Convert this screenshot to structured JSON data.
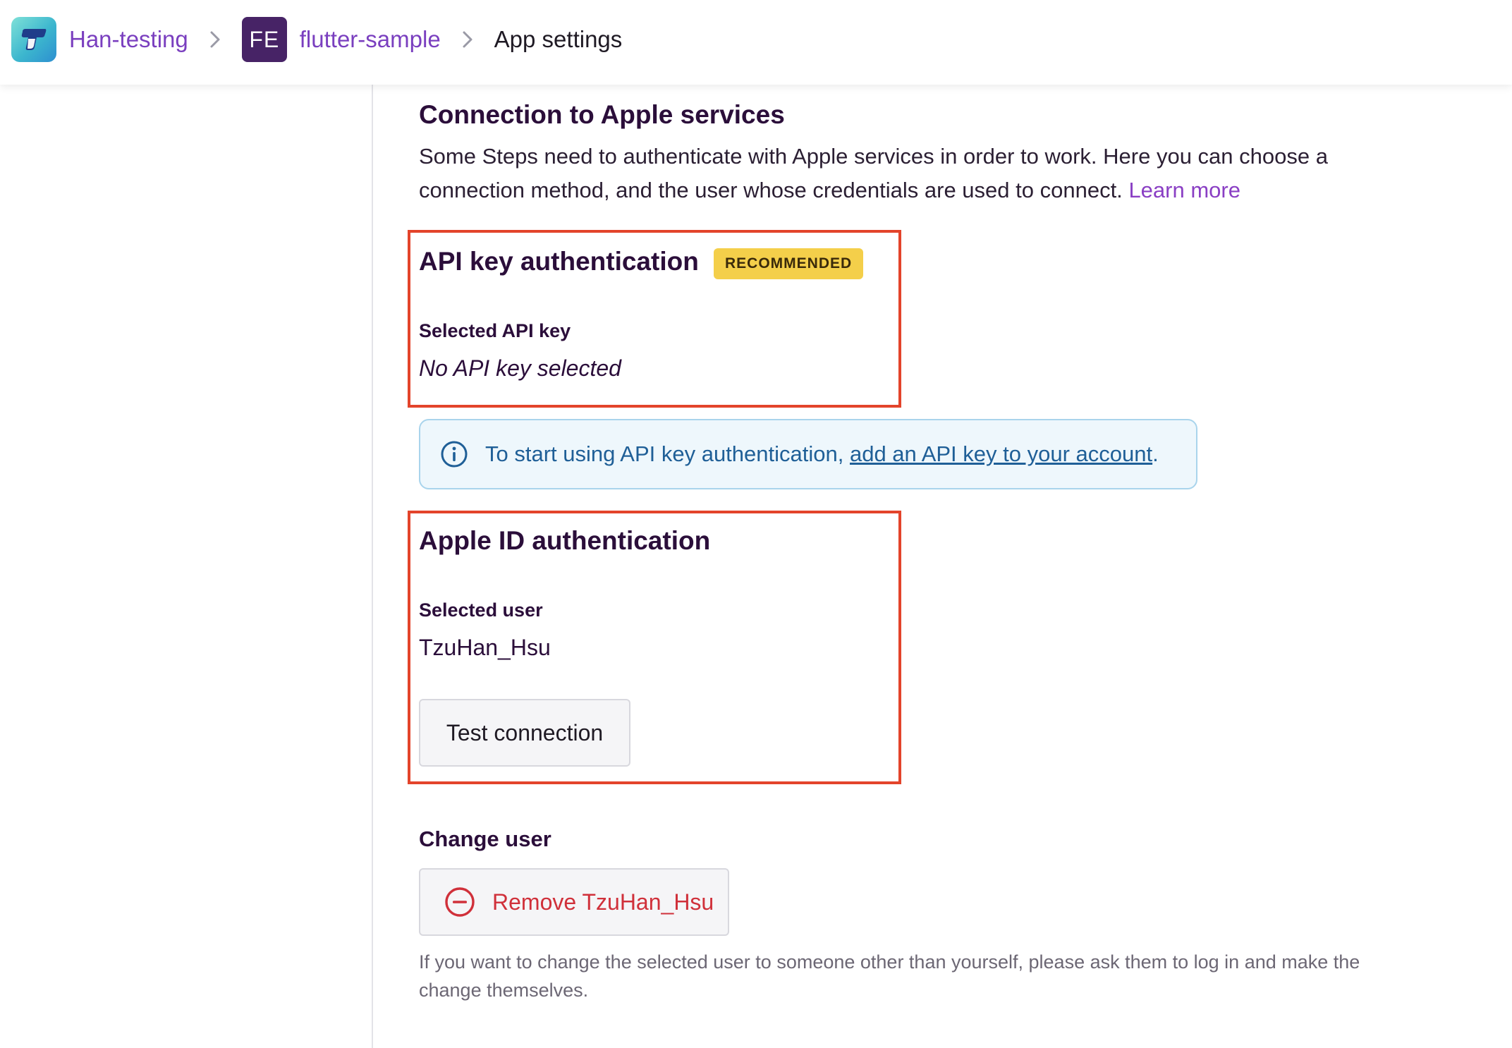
{
  "breadcrumb": {
    "workspace": "Han-testing",
    "project_badge": "FE",
    "project": "flutter-sample",
    "current": "App settings"
  },
  "section": {
    "title": "Connection to Apple services",
    "description": "Some Steps need to authenticate with Apple services in order to work. Here you can choose a connection method, and the user whose credentials are used to connect.",
    "learn_more": "Learn more"
  },
  "api_key": {
    "title": "API key authentication",
    "badge": "RECOMMENDED",
    "label": "Selected API key",
    "value": "No API key selected"
  },
  "info": {
    "prefix": "To start using API key authentication, ",
    "link": "add an API key to your account",
    "suffix": "."
  },
  "apple_id": {
    "title": "Apple ID authentication",
    "label": "Selected user",
    "value": "TzuHan_Hsu",
    "test_button": "Test connection"
  },
  "change_user": {
    "title": "Change user",
    "remove_button": "Remove TzuHan_Hsu",
    "help": "If you want to change the selected user to someone other than yourself, please ask them to log in and make the change themselves."
  },
  "colors": {
    "accent": "#7a3fbf",
    "highlight": "#e3442b",
    "badge": "#f4cf4a",
    "danger": "#d0303a",
    "info": "#1f5f97"
  },
  "icons": [
    "bitrise-logo-icon",
    "chevron-right-icon",
    "info-icon",
    "minus-circle-icon"
  ]
}
